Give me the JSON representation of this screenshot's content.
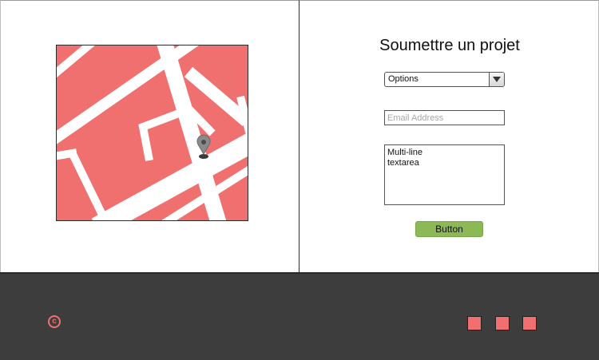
{
  "form": {
    "title": "Soumettre un projet",
    "select_value": "Options",
    "email_placeholder": "Email Address",
    "textarea_value": "Multi-line\ntextarea",
    "button_label": "Button"
  },
  "map": {
    "marker_icon": "map-pin-icon"
  },
  "footer": {
    "copyright_symbol": "c",
    "social_icons": [
      "social-icon",
      "social-icon",
      "social-icon"
    ]
  },
  "colors": {
    "map_fill": "#f07070",
    "road": "#ffffff",
    "button": "#8cb955",
    "footer_bg": "#3d3d3d",
    "accent": "#f07070"
  }
}
